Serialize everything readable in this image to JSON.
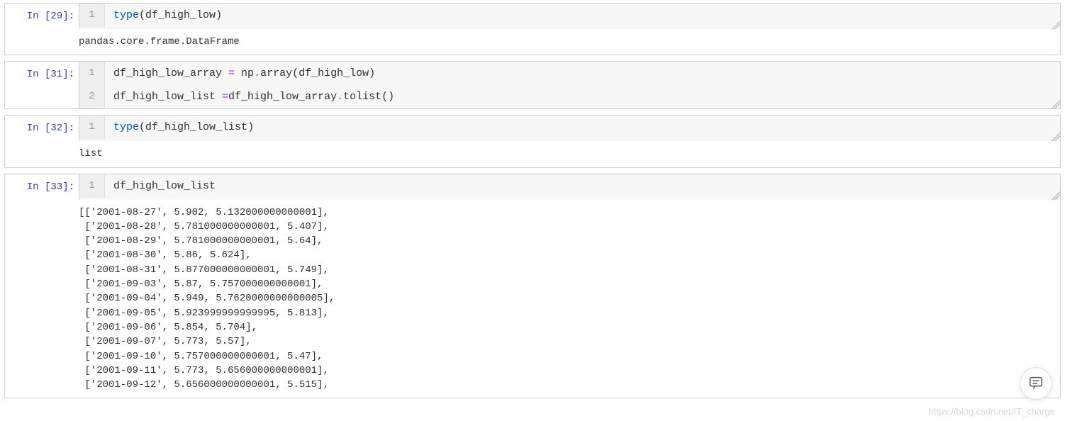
{
  "cells": [
    {
      "id": "cell29",
      "prompt": "In [29]:",
      "lines": [
        {
          "num": "1",
          "tokens": [
            {
              "t": "type",
              "c": "nm"
            },
            {
              "t": "(",
              "c": "par"
            },
            {
              "t": "df_high_low",
              "c": "id"
            },
            {
              "t": ")",
              "c": "par"
            }
          ]
        }
      ],
      "output": "pandas.core.frame.DataFrame"
    },
    {
      "id": "cell31",
      "prompt": "In [31]:",
      "lines": [
        {
          "num": "1",
          "tokens": [
            {
              "t": "df_high_low_array ",
              "c": "id"
            },
            {
              "t": "=",
              "c": "op"
            },
            {
              "t": " np",
              "c": "id"
            },
            {
              "t": ".",
              "c": "op"
            },
            {
              "t": "array",
              "c": "id"
            },
            {
              "t": "(",
              "c": "par"
            },
            {
              "t": "df_high_low",
              "c": "id"
            },
            {
              "t": ")",
              "c": "par"
            }
          ]
        },
        {
          "num": "2",
          "tokens": [
            {
              "t": "df_high_low_list ",
              "c": "id"
            },
            {
              "t": "=",
              "c": "op"
            },
            {
              "t": "df_high_low_array",
              "c": "id"
            },
            {
              "t": ".",
              "c": "op"
            },
            {
              "t": "tolist",
              "c": "id"
            },
            {
              "t": "()",
              "c": "par"
            }
          ]
        }
      ],
      "output": null
    },
    {
      "id": "cell32",
      "prompt": "In [32]:",
      "lines": [
        {
          "num": "1",
          "tokens": [
            {
              "t": "type",
              "c": "nm"
            },
            {
              "t": "(",
              "c": "par"
            },
            {
              "t": "df_high_low_list",
              "c": "id"
            },
            {
              "t": ")",
              "c": "par"
            }
          ]
        }
      ],
      "output": "list"
    },
    {
      "id": "cell33",
      "prompt": "In [33]:",
      "lines": [
        {
          "num": "1",
          "tokens": [
            {
              "t": "df_high_low_list",
              "c": "id"
            }
          ]
        }
      ],
      "output": "[['2001-08-27', 5.902, 5.132000000000001],\n ['2001-08-28', 5.781000000000001, 5.407],\n ['2001-08-29', 5.781000000000001, 5.64],\n ['2001-08-30', 5.86, 5.624],\n ['2001-08-31', 5.877000000000001, 5.749],\n ['2001-09-03', 5.87, 5.757000000000001],\n ['2001-09-04', 5.949, 5.7620000000000005],\n ['2001-09-05', 5.923999999999995, 5.813],\n ['2001-09-06', 5.854, 5.704],\n ['2001-09-07', 5.773, 5.57],\n ['2001-09-10', 5.757000000000001, 5.47],\n ['2001-09-11', 5.773, 5.656000000000001],\n ['2001-09-12', 5.656000000000001, 5.515],"
    }
  ],
  "watermark": "https://blog.csdn.net/IT_charge",
  "chat_icon": "chat-icon"
}
